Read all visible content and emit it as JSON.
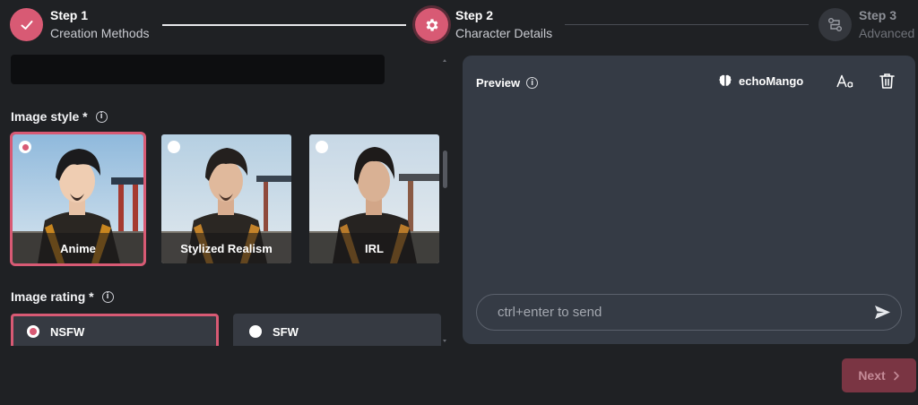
{
  "stepper": {
    "steps": [
      {
        "title": "Step 1",
        "subtitle": "Creation Methods",
        "state": "completed",
        "icon": "check-icon"
      },
      {
        "title": "Step 2",
        "subtitle": "Character Details",
        "state": "current",
        "icon": "gear-icon"
      },
      {
        "title": "Step 3",
        "subtitle": "Advanced",
        "state": "upcoming",
        "icon": "flow-icon"
      }
    ]
  },
  "form": {
    "image_style": {
      "label": "Image style *",
      "info_icon": "info-icon",
      "selected": "Anime",
      "options": [
        {
          "label": "Anime",
          "selected": true
        },
        {
          "label": "Stylized Realism",
          "selected": false
        },
        {
          "label": "IRL",
          "selected": false
        }
      ]
    },
    "image_rating": {
      "label": "Image rating *",
      "info_icon": "info-icon",
      "selected": "NSFW",
      "options": [
        {
          "label": "NSFW",
          "selected": true
        },
        {
          "label": "SFW",
          "selected": false
        }
      ]
    }
  },
  "preview": {
    "title": "Preview",
    "model_name": "echoMango",
    "model_icon": "brain-icon",
    "font_icon": "font-size-icon",
    "trash_icon": "trash-icon",
    "input_placeholder": "ctrl+enter to send",
    "send_icon": "send-icon"
  },
  "footer": {
    "next_label": "Next",
    "next_icon": "chevron-right-icon"
  },
  "colors": {
    "accent": "#d85a74",
    "background": "#1f2124",
    "panel": "#353b45",
    "next_disabled": "#7a3543"
  }
}
